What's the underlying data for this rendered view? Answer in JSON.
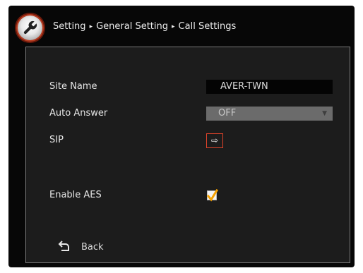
{
  "breadcrumb": {
    "items": [
      "Setting",
      "General Setting",
      "Call Settings"
    ],
    "separator": "▸"
  },
  "fields": {
    "site_name": {
      "label": "Site Name",
      "value": "AVER-TWN"
    },
    "auto_answer": {
      "label": "Auto Answer",
      "value": "OFF"
    },
    "sip": {
      "label": "SIP",
      "button_glyph": "⇨"
    },
    "enable_aes": {
      "label": "Enable AES",
      "checked": true
    }
  },
  "back": {
    "label": "Back"
  },
  "icons": {
    "header": "wrench-icon",
    "sip": "arrow-right-icon",
    "back": "return-arrow-icon"
  },
  "colors": {
    "background": "#070707",
    "panel": "#1c1c1c",
    "accent": "#e0432a",
    "check": "#f5a000"
  }
}
